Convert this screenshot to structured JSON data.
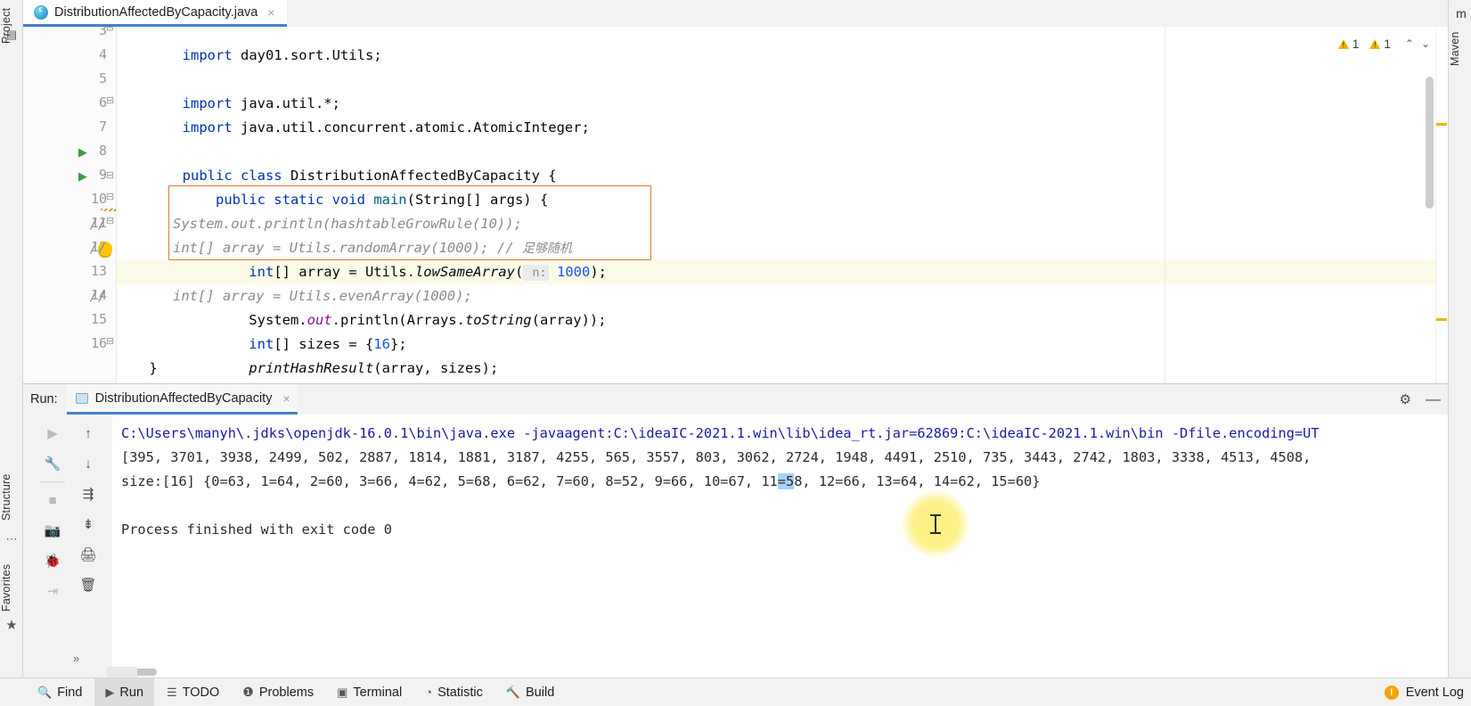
{
  "window": {
    "left_rail": [
      {
        "name": "project",
        "label": "Project",
        "icon": "project-icon"
      },
      {
        "name": "structure",
        "label": "Structure",
        "icon": "structure-icon"
      },
      {
        "name": "favorites",
        "label": "Favorites",
        "icon": "favorites-icon"
      }
    ],
    "right_rail": [
      {
        "name": "maven",
        "label": "Maven",
        "icon": "maven-icon"
      }
    ]
  },
  "editor_tab": {
    "title": "DistributionAffectedByCapacity.java",
    "icon": "java-class-icon",
    "close": "×"
  },
  "inspections": {
    "warning_count_1": "1",
    "warning_count_2": "1",
    "chevron_up": "⌃",
    "chevron_down": "⌄"
  },
  "code": {
    "first_visible_line": 3,
    "lines": [
      {
        "no": "3",
        "text": "import day01.sort.Utils;",
        "clipped": true
      },
      {
        "no": "4",
        "text": ""
      },
      {
        "no": "5",
        "text": "import java.util.*;"
      },
      {
        "no": "6",
        "text": "import java.util.concurrent.atomic.AtomicInteger;"
      },
      {
        "no": "7",
        "text": ""
      },
      {
        "no": "8",
        "text": "public class DistributionAffectedByCapacity {"
      },
      {
        "no": "9",
        "text": "    public static void main(String[] args) {"
      },
      {
        "no": "10",
        "text": "//        System.out.println(hashtableGrowRule(10));"
      },
      {
        "no": "11",
        "text": "//        int[] array = Utils.randomArray(1000); // 足够随机"
      },
      {
        "no": "12",
        "text": "        int[] array = Utils.lowSameArray( n: 1000);"
      },
      {
        "no": "13",
        "text": "//        int[] array = Utils.evenArray(1000);"
      },
      {
        "no": "14",
        "text": "        System.out.println(Arrays.toString(array));"
      },
      {
        "no": "15",
        "text": "        int[] sizes = {16};"
      },
      {
        "no": "16",
        "text": "        printHashResult(array, sizes);"
      },
      {
        "no": "17",
        "text": "    }"
      }
    ],
    "param_hint": "n:",
    "chinese_comment": "足够随机",
    "highlight_color": "#e8762c",
    "caret_line": 13
  },
  "run_window": {
    "label": "Run:",
    "tab_title": "DistributionAffectedByCapacity",
    "tab_close": "×",
    "settings_icon": "gear-icon",
    "minimize_icon": "minimize-icon",
    "toolbar_left": [
      {
        "name": "rerun-button",
        "icon": "▶",
        "dim": true
      },
      {
        "name": "settings-wrench-button",
        "icon": "ᴠ",
        "dim": false
      },
      {
        "name": "stop-button",
        "icon": "■",
        "dim": true
      },
      {
        "name": "screenshot-button",
        "icon": "▣",
        "dim": true
      },
      {
        "name": "debug-button",
        "icon": "✱",
        "dim": true
      },
      {
        "name": "export-button",
        "icon": "⇥",
        "dim": true
      }
    ],
    "toolbar_right": [
      {
        "name": "scroll-up-button",
        "icon": "↑"
      },
      {
        "name": "scroll-down-button",
        "icon": "↓"
      },
      {
        "name": "soft-wrap-button",
        "icon": "↩"
      },
      {
        "name": "scroll-to-end-button",
        "icon": "⤓"
      },
      {
        "name": "print-button",
        "icon": "⎙"
      },
      {
        "name": "clear-all-button",
        "icon": "🗑"
      }
    ]
  },
  "console": {
    "lines": [
      {
        "text": "C:\\Users\\manyh\\.jdks\\openjdk-16.0.1\\bin\\java.exe -javaagent:C:\\ideaIC-2021.1.win\\lib\\idea_rt.jar=62869:C:\\ideaIC-2021.1.win\\bin -Dfile.encoding=UT",
        "style": "blue"
      },
      {
        "text": "[395, 3701, 3938, 2499, 502, 2887, 1814, 1881, 3187, 4255, 565, 3557, 803, 3062, 2724, 1948, 4491, 2510, 735, 3443, 2742, 1803, 3338, 4513, 4508,",
        "style": "plain"
      },
      {
        "text": "size:[16] {0=63, 1=64, 2=60, 3=66, 4=62, 5=68, 6=62, 7=60, 8=52, 9=66, 10=67, 11=58, 12=66, 13=64, 14=62, 15=60}",
        "style": "plain"
      },
      {
        "text": "",
        "style": "plain"
      },
      {
        "text": "Process finished with exit code 0",
        "style": "plain"
      }
    ],
    "selection_text": "=5",
    "hash_result": {
      "size": 16,
      "buckets": [
        {
          "key": "0",
          "value": 63
        },
        {
          "key": "1",
          "value": 64
        },
        {
          "key": "2",
          "value": 60
        },
        {
          "key": "3",
          "value": 66
        },
        {
          "key": "4",
          "value": 62
        },
        {
          "key": "5",
          "value": 68
        },
        {
          "key": "6",
          "value": 62
        },
        {
          "key": "7",
          "value": 60
        },
        {
          "key": "8",
          "value": 52
        },
        {
          "key": "9",
          "value": 66
        },
        {
          "key": "10",
          "value": 67
        },
        {
          "key": "11",
          "value": 58
        },
        {
          "key": "12",
          "value": 66
        },
        {
          "key": "13",
          "value": 64
        },
        {
          "key": "14",
          "value": 62
        },
        {
          "key": "15",
          "value": 60
        }
      ]
    }
  },
  "status_bar": {
    "items": [
      {
        "name": "find",
        "label": "Find",
        "icon": "search-icon",
        "active": false
      },
      {
        "name": "run",
        "label": "Run",
        "icon": "play-icon",
        "active": true
      },
      {
        "name": "todo",
        "label": "TODO",
        "icon": "list-icon",
        "active": false
      },
      {
        "name": "problems",
        "label": "Problems",
        "icon": "warning-icon",
        "active": false
      },
      {
        "name": "terminal",
        "label": "Terminal",
        "icon": "terminal-icon",
        "active": false
      },
      {
        "name": "statistic",
        "label": "Statistic",
        "icon": "pie-icon",
        "active": false
      },
      {
        "name": "build",
        "label": "Build",
        "icon": "hammer-icon",
        "active": false
      }
    ],
    "event_log": {
      "label": "Event Log",
      "badge": "!"
    },
    "expand_chevron": "»"
  }
}
